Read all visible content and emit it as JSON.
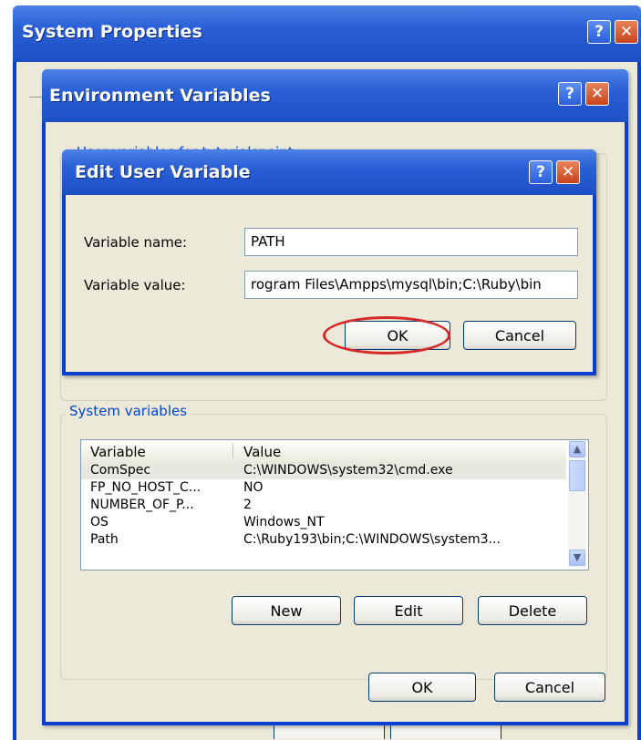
{
  "system_properties": {
    "title": "System Properties",
    "help": "?",
    "close": "✕"
  },
  "env_vars": {
    "title": "Environment Variables",
    "help": "?",
    "close": "✕",
    "user_vars_label": "User variables for tutorialspoint",
    "system_vars_label": "System variables",
    "columns": [
      "Variable",
      "Value"
    ],
    "rows": [
      {
        "variable": "ComSpec",
        "value": "C:\\WINDOWS\\system32\\cmd.exe",
        "selected": true
      },
      {
        "variable": "FP_NO_HOST_C...",
        "value": "NO"
      },
      {
        "variable": "NUMBER_OF_P...",
        "value": "2"
      },
      {
        "variable": "OS",
        "value": "Windows_NT"
      },
      {
        "variable": "Path",
        "value": "C:\\Ruby193\\bin;C:\\WINDOWS\\system3..."
      }
    ],
    "new_label": "New",
    "edit_label": "Edit",
    "delete_label": "Delete",
    "ok_label": "OK",
    "cancel_label": "Cancel"
  },
  "edit_dialog": {
    "title": "Edit User Variable",
    "help": "?",
    "close": "✕",
    "name_label": "Variable name:",
    "name_value": "PATH",
    "value_label": "Variable value:",
    "value_value": "rogram Files\\Ampps\\mysql\\bin;C:\\Ruby\\bin",
    "ok_label": "OK",
    "cancel_label": "Cancel",
    "highlight_color": "#d42b2b"
  }
}
